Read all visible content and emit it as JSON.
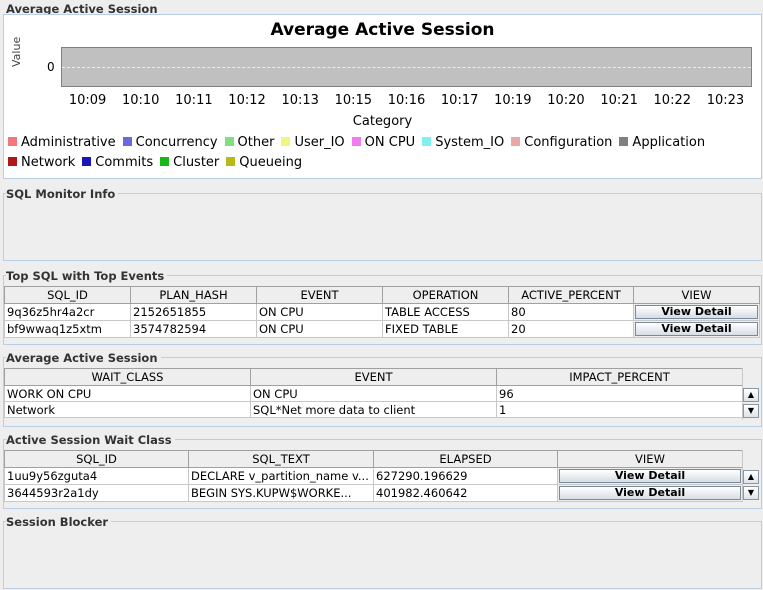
{
  "chart_panel": {
    "title": "Average Active Session",
    "chart_data": {
      "type": "bar",
      "title": "Average Active Session",
      "xlabel": "Category",
      "ylabel": "Value",
      "y_ticks": [
        "0"
      ],
      "categories": [
        "10:09",
        "10:10",
        "10:11",
        "10:12",
        "10:13",
        "10:15",
        "10:16",
        "10:17",
        "10:19",
        "10:20",
        "10:21",
        "10:22",
        "10:23"
      ],
      "series": [
        {
          "name": "Administrative",
          "color": "#f07878"
        },
        {
          "name": "Concurrency",
          "color": "#6a6ae0"
        },
        {
          "name": "Other",
          "color": "#80e080"
        },
        {
          "name": "User_IO",
          "color": "#f4f480"
        },
        {
          "name": "ON CPU",
          "color": "#f07cf0"
        },
        {
          "name": "System_IO",
          "color": "#80f0f0"
        },
        {
          "name": "Configuration",
          "color": "#e8a8a8"
        },
        {
          "name": "Application",
          "color": "#808080"
        },
        {
          "name": "Network",
          "color": "#b01818"
        },
        {
          "name": "Commits",
          "color": "#1818b8"
        },
        {
          "name": "Cluster",
          "color": "#18b818"
        },
        {
          "name": "Queueing",
          "color": "#b8b818"
        }
      ],
      "grid": true,
      "legend": "bottom"
    }
  },
  "sql_monitor": {
    "title": "SQL Monitor Info"
  },
  "top_sql": {
    "title": "Top SQL with Top Events",
    "columns": [
      "SQL_ID",
      "PLAN_HASH",
      "EVENT",
      "OPERATION",
      "ACTIVE_PERCENT",
      "VIEW"
    ],
    "rows": [
      {
        "sql_id": "9q36z5hr4a2cr",
        "plan_hash": "2152651855",
        "event": "ON CPU",
        "operation": "TABLE ACCESS",
        "active_percent": "80",
        "view": "View Detail"
      },
      {
        "sql_id": "bf9wwaq1z5xtm",
        "plan_hash": "3574782594",
        "event": "ON CPU",
        "operation": "FIXED TABLE",
        "active_percent": "20",
        "view": "View Detail"
      }
    ]
  },
  "avg_active": {
    "title": "Average Active Session",
    "columns": [
      "WAIT_CLASS",
      "EVENT",
      "IMPACT_PERCENT"
    ],
    "rows": [
      {
        "wait_class": "WORK ON CPU",
        "event": "ON CPU",
        "impact_percent": "96"
      },
      {
        "wait_class": "Network",
        "event": "SQL*Net more data to client",
        "impact_percent": "1"
      }
    ]
  },
  "wait_class": {
    "title": "Active Session Wait Class",
    "columns": [
      "SQL_ID",
      "SQL_TEXT",
      "ELAPSED",
      "VIEW"
    ],
    "rows": [
      {
        "sql_id": "1uu9y56zguta4",
        "sql_text": "DECLARE  v_partition_name v...",
        "elapsed": "627290.196629",
        "view": "View Detail"
      },
      {
        "sql_id": "3644593r2a1dy",
        "sql_text": "BEGIN    SYS.KUPW$WORKE...",
        "elapsed": "401982.460642",
        "view": "View Detail"
      }
    ]
  },
  "session_blocker": {
    "title": "Session Blocker"
  }
}
